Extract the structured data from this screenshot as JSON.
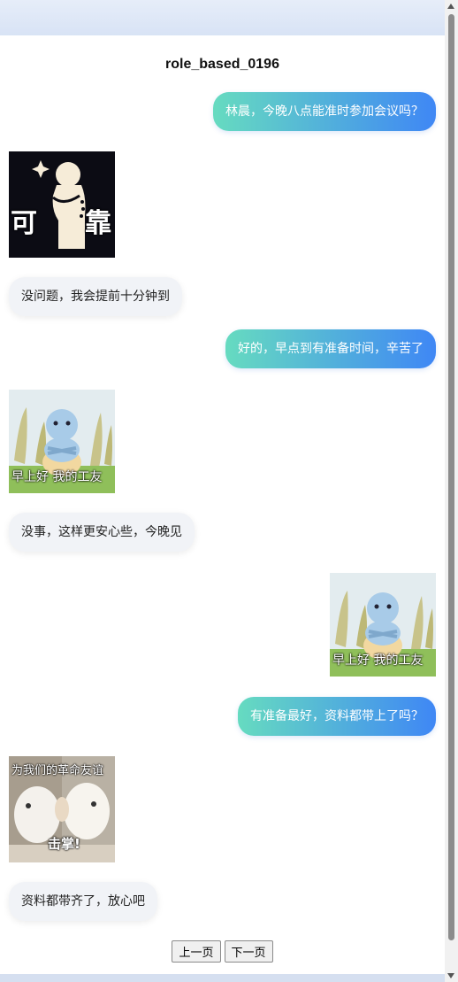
{
  "page": {
    "title": "role_based_0196"
  },
  "messages": [
    {
      "side": "right",
      "type": "text",
      "text": "林晨，今晚八点能准时参加会议吗？"
    },
    {
      "side": "left",
      "type": "sticker",
      "sticker": "reliable-sticker",
      "caption_left": "可",
      "caption_right": "靠"
    },
    {
      "side": "left",
      "type": "text",
      "text": "没问题，我会提前十分钟到"
    },
    {
      "side": "right",
      "type": "text",
      "text": "好的，早点到有准备时间，辛苦了"
    },
    {
      "side": "left",
      "type": "sticker",
      "sticker": "good-morning-sticker",
      "caption": "早上好 我的工友"
    },
    {
      "side": "left",
      "type": "text",
      "text": "没事，这样更安心些，今晚见"
    },
    {
      "side": "right",
      "type": "sticker",
      "sticker": "good-morning-sticker",
      "caption": "早上好 我的工友"
    },
    {
      "side": "right",
      "type": "text",
      "text": "有准备最好，资料都带上了吗？"
    },
    {
      "side": "left",
      "type": "sticker",
      "sticker": "high-five-sticker",
      "caption_top": "为我们的革命友谊",
      "caption_bottom": "击掌!"
    },
    {
      "side": "left",
      "type": "text",
      "text": "资料都带齐了，放心吧"
    }
  ],
  "pagination": {
    "prev_label": "上一页",
    "next_label": "下一页"
  },
  "colors": {
    "bubble_gradient_start": "#66dbc0",
    "bubble_gradient_end": "#3f87f5",
    "left_bubble_bg": "#f1f3f7"
  }
}
